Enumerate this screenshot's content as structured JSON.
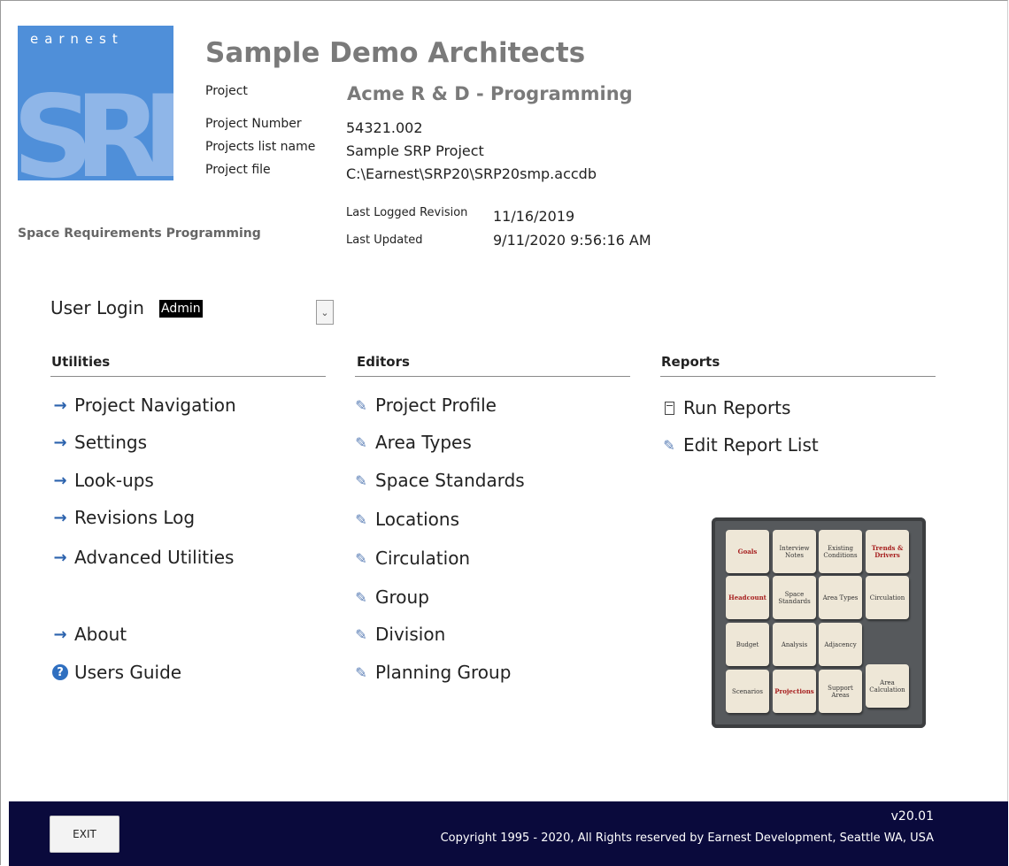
{
  "header": {
    "logo_word": "earnest",
    "logo_letters": "SRP",
    "company": "Sample Demo Architects",
    "tagline": "Space Requirements Programming"
  },
  "project": {
    "project_label": "Project",
    "project_value": "Acme R & D - Programming",
    "number_label": "Project Number",
    "number_value": "54321.002",
    "list_label": "Projects list name",
    "list_value": "Sample SRP Project",
    "file_label": "Project file",
    "file_value": "C:\\Earnest\\SRP20\\SRP20smp.accdb",
    "revision_label": "Last Logged Revision",
    "revision_value": "11/16/2019",
    "updated_label": "Last Updated",
    "updated_value": "9/11/2020 9:56:16 AM"
  },
  "login": {
    "label": "User Login",
    "value": "Admin"
  },
  "utilities": {
    "heading": "Utilities",
    "items": [
      "Project Navigation",
      "Settings",
      "Look-ups",
      "Revisions Log",
      "Advanced Utilities"
    ],
    "about": "About",
    "guide": "Users Guide"
  },
  "editors": {
    "heading": "Editors",
    "items": [
      "Project Profile",
      "Area Types",
      "Space Standards",
      "Locations",
      "Circulation",
      "Group",
      "Division",
      "Planning Group"
    ]
  },
  "reports": {
    "heading": "Reports",
    "items": [
      "Run Reports",
      "Edit Report List"
    ]
  },
  "puzzle": {
    "tiles": [
      "Goals",
      "Interview Notes",
      "Existing Conditions",
      "Trends & Drivers",
      "Headcount",
      "Space Standards",
      "Area Types",
      "Circulation",
      "Budget",
      "Analysis",
      "Adjacency",
      "Scenarios",
      "Projections",
      "Support Areas",
      "Area Calculation"
    ]
  },
  "footer": {
    "version": "v20.01",
    "copyright": "Copyright 1995 - 2020, All Rights reserved by Earnest Development, Seattle WA, USA",
    "exit_label": "EXIT"
  },
  "colors": {
    "footer_bg": "#0a0a3c",
    "logo_bg": "#4f8fd9",
    "link_icon": "#2b62ad",
    "accent_red": "#a61d1d"
  }
}
